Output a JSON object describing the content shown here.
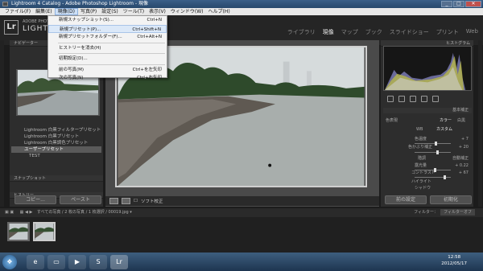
{
  "window": {
    "title": "Lightroom 4 Catalog - Adobe Photoshop Lightroom - 現像",
    "buttons": {
      "minimize": "_",
      "maximize": "□",
      "close": "✕"
    }
  },
  "menubar": [
    "ファイル(F)",
    "編集(E)",
    "現像(D)",
    "写真(P)",
    "設定(S)",
    "ツール(T)",
    "表示(V)",
    "ウィンドウ(W)",
    "ヘルプ(H)"
  ],
  "menu_active_index": 2,
  "dropdown": {
    "items": [
      {
        "label": "新規スナップショット(S)...",
        "shortcut": "Ctrl+N"
      },
      {
        "label": "新規プリセット(P)...",
        "shortcut": "Ctrl+Shift+N",
        "highlighted": true
      },
      {
        "label": "新規プリセットフォルダー(F)...",
        "shortcut": "Ctrl+Alt+N"
      },
      {
        "label": "ヒストリーを消去(H)",
        "shortcut": ""
      },
      {
        "label": "初期設定(D)...",
        "shortcut": ""
      },
      {
        "label": "前の写真(M)",
        "shortcut": "Ctrl+を左矢印"
      },
      {
        "label": "次の写真(N)",
        "shortcut": "Ctrl+右矢印"
      }
    ]
  },
  "identity": {
    "logo": "Lr",
    "line1": "ADOBE PHOTOSHOP",
    "line2": "LIGHTROOM 4"
  },
  "modules": [
    "ライブラリ",
    "現像",
    "マップ",
    "ブック",
    "スライドショー",
    "プリント",
    "Web"
  ],
  "module_active_index": 1,
  "left": {
    "navigator": "ナビゲーター",
    "presets": [
      "Lightroom 白黒フィルタープリセット",
      "Lightroom 白黒プリセット",
      "Lightroom 白黒調色プリセット",
      "ユーザープリセット",
      "TEST"
    ],
    "snapshot": "スナップショット",
    "history": "ヒストリー",
    "copy_btn": "コピー...",
    "paste_btn": "ペースト"
  },
  "center": {
    "softproof": "ソフト校正"
  },
  "right": {
    "histogram": "ヒストグラム",
    "basic": "基本補正",
    "treatment": "色表現",
    "color": "カラー",
    "bw": "白黒",
    "wb": "WB",
    "wb_value": "カスタム",
    "temp": "色温度",
    "temp_val": "+ 7",
    "tint": "色かぶり補正",
    "tint_val": "+ 20",
    "tone": "階調",
    "auto": "自動補正",
    "exposure": "露光量",
    "exposure_val": "+ 0.22",
    "contrast": "コントラスト",
    "contrast_val": "+ 67",
    "highlights": "ハイライト",
    "shadows": "シャドウ",
    "prev_btn": "前の設定",
    "reset_btn": "初期化"
  },
  "filmstrip": {
    "path": "すべての写真 / 2 枚の写真 / 1 枚選択 / 00019.jpg ▾",
    "filter_label": "フィルター：",
    "filter_value": "フィルターオフ"
  },
  "taskbar": {
    "time": "12:58",
    "date": "2012/05/17"
  },
  "colors": {
    "accent": "#3b5f88",
    "panel": "#2d2d2d"
  }
}
